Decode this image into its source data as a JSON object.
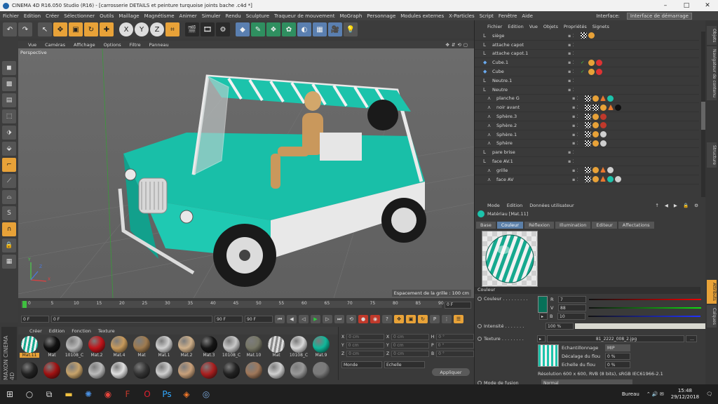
{
  "window": {
    "title": "CINEMA 4D R16.050 Studio (R16) - [carrosserie DETAILS et peinture turquoise  joints bache .c4d *]",
    "min": "–",
    "max": "□",
    "close": "✕"
  },
  "menu": [
    "Fichier",
    "Edition",
    "Créer",
    "Sélectionner",
    "Outils",
    "Maillage",
    "Magnétisme",
    "Animer",
    "Simuler",
    "Rendu",
    "Sculpture",
    "Traqueur de mouvement",
    "MoGraph",
    "Personnage",
    "Modules externes",
    "X-Particles",
    "Script",
    "Fenêtre",
    "Aide"
  ],
  "interface": {
    "label": "Interface:",
    "value": "Interface de démarrage"
  },
  "viewport": {
    "menu": [
      "Vue",
      "Caméras",
      "Affichage",
      "Options",
      "Filtre",
      "Panneau"
    ],
    "label": "Perspective",
    "grid_note": "Espacement de la grille : 100 cm",
    "axis_x": "X",
    "axis_y": "Y",
    "axis_z": "Z"
  },
  "timeline": {
    "ticks": [
      "0",
      "5",
      "10",
      "15",
      "20",
      "25",
      "30",
      "35",
      "40",
      "45",
      "50",
      "55",
      "60",
      "65",
      "70",
      "75",
      "80",
      "85",
      "90"
    ],
    "current": "0 F"
  },
  "transport": {
    "start": "0 F",
    "current": "0 F",
    "end": "90 F",
    "end2": "90 F"
  },
  "materials": {
    "menu": [
      "Créer",
      "Edition",
      "Fonction",
      "Texture"
    ],
    "items": [
      {
        "label": "Mat.11",
        "color": "stripe"
      },
      {
        "label": "Mat",
        "color": "#111111"
      },
      {
        "label": "10108_C",
        "color": "#b8b8b8"
      },
      {
        "label": "Mat.2",
        "color": "#c0151a"
      },
      {
        "label": "Mat.4",
        "color": "#c79a5c"
      },
      {
        "label": "Mat",
        "color": "#9f7b4f"
      },
      {
        "label": "Mat.1",
        "color": "#d0d0d0"
      },
      {
        "label": "Mat.2",
        "color": "#cfb08a"
      },
      {
        "label": "Mat.3",
        "color": "#151515"
      },
      {
        "label": "10108_C",
        "color": "#c8c8c8"
      },
      {
        "label": "Mat.10",
        "color": "#777766"
      },
      {
        "label": "Mat",
        "color": "stripegrey"
      },
      {
        "label": "10108_C",
        "color": "#d8d8d8"
      },
      {
        "label": "Mat.9",
        "color": "#10b79a"
      },
      {
        "label": "",
        "color": "#222222"
      },
      {
        "label": "",
        "color": "#a01212"
      },
      {
        "label": "",
        "color": "#c7a36a"
      },
      {
        "label": "",
        "color": "#bbbbbb"
      },
      {
        "label": "",
        "color": "#e0e0e0"
      },
      {
        "label": "",
        "color": "#333333"
      },
      {
        "label": "",
        "color": "#cfcfcf"
      },
      {
        "label": "",
        "color": "#c8a07a"
      },
      {
        "label": "",
        "color": "#aa2020"
      },
      {
        "label": "",
        "color": "#222222"
      },
      {
        "label": "",
        "color": "#a0785a"
      },
      {
        "label": "",
        "color": "#d0d0d0"
      },
      {
        "label": "",
        "color": "#999999"
      },
      {
        "label": "",
        "color": "#7a7a7a"
      }
    ]
  },
  "coords": {
    "rows": [
      {
        "a": "X",
        "av": "0 cm",
        "b": "X",
        "bv": "0 cm",
        "c": "H",
        "cv": "0 °"
      },
      {
        "a": "Y",
        "av": "0 cm",
        "b": "Y",
        "bv": "0 cm",
        "c": "P",
        "cv": "0 °"
      },
      {
        "a": "Z",
        "av": "0 cm",
        "b": "Z",
        "bv": "0 cm",
        "c": "B",
        "cv": "0 °"
      }
    ],
    "mode1": "Monde",
    "mode2": "Echelle",
    "apply": "Appliquer"
  },
  "objects": {
    "menu": [
      "Fichier",
      "Edition",
      "Vue",
      "Objets",
      "Propriétés",
      "Signets"
    ],
    "rows": [
      {
        "name": "siège",
        "icon": "L0",
        "tags": [
          "x",
          "o"
        ]
      },
      {
        "name": "attache capot",
        "icon": "L0",
        "tags": []
      },
      {
        "name": "attache capot.1",
        "icon": "L0",
        "tags": []
      },
      {
        "name": "Cube.1",
        "icon": "cube",
        "tags": [
          "chk",
          "o",
          "r"
        ]
      },
      {
        "name": "Cube",
        "icon": "cube",
        "tags": [
          "chk",
          "o",
          "r"
        ]
      },
      {
        "name": "Neutre.1",
        "icon": "L0",
        "tags": []
      },
      {
        "name": "Neutre",
        "icon": "L0",
        "tags": []
      },
      {
        "name": "planche G",
        "icon": "bone",
        "tags": [
          "x",
          "o",
          "t",
          "g"
        ]
      },
      {
        "name": "noir avant",
        "icon": "bone",
        "tags": [
          "x",
          "x",
          "o",
          "t",
          "k"
        ]
      },
      {
        "name": "Sphère.3",
        "icon": "bone",
        "tags": [
          "x",
          "o",
          "b"
        ]
      },
      {
        "name": "Sphère.2",
        "icon": "bone",
        "tags": [
          "x",
          "o",
          "b"
        ]
      },
      {
        "name": "Sphère.1",
        "icon": "bone",
        "tags": [
          "x",
          "o",
          "w"
        ]
      },
      {
        "name": "Sphère",
        "icon": "bone",
        "tags": [
          "x",
          "o",
          "w"
        ]
      },
      {
        "name": "pare brise",
        "icon": "L0",
        "tags": []
      },
      {
        "name": "face AV.1",
        "icon": "L0",
        "tags": []
      },
      {
        "name": "grille",
        "icon": "bone",
        "tags": [
          "x",
          "o",
          "t",
          "w"
        ]
      },
      {
        "name": "face AV",
        "icon": "bone",
        "tags": [
          "x",
          "o",
          "t",
          "g",
          "w"
        ]
      }
    ]
  },
  "attributes": {
    "menu": [
      "Mode",
      "Edition",
      "Données utilisateur"
    ],
    "title": "Matériau [Mat.11]",
    "tabs": [
      "Base",
      "Couleur",
      "Réflexion",
      "Illumination",
      "Editeur",
      "Affectations"
    ],
    "active_tab": "Couleur",
    "section": "Couleur",
    "couleur_label": "Couleur . . . . . . . . .",
    "swatch": "#077058",
    "r_label": "R",
    "r_val": "7",
    "v_label": "V",
    "v_val": "88",
    "b_label": "B",
    "b_val": "10",
    "intensite_label": "Intensité . . . . . . .",
    "intensite_val": "100 %",
    "texture_label": "Texture . . . . . . . .",
    "texture_file": "81_2222_008_2.jpg",
    "echant_label": "Echantillonnage",
    "echant_val": "MIP",
    "decal_label": "Décalage du flou",
    "decal_val": "0 %",
    "echelle_label": "Echelle du flou",
    "echelle_val": "0 %",
    "resolution": "Résolution 600 x 600, RVB (8 bits), sRGB IEC61966-2.1",
    "fusion_label": "Mode de fusion",
    "fusion_val": "Normal"
  },
  "right_tabs": [
    "Objets",
    "Navigateur de contenu",
    "Structure",
    "Attributs",
    "Calques"
  ],
  "taskbar": {
    "bureau": "Bureau",
    "time": "15:48",
    "date": "29/12/2018"
  }
}
